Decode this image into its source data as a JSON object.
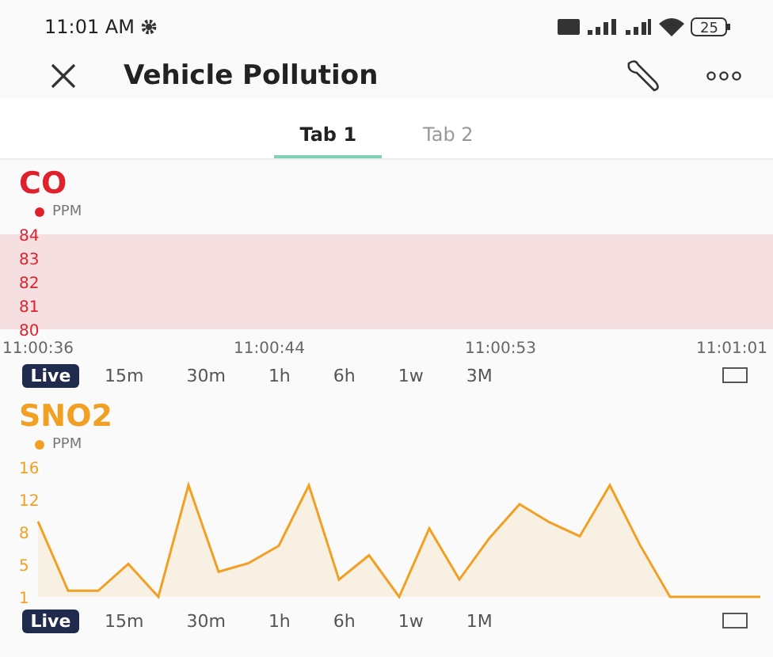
{
  "status_bar": {
    "time": "11:01 AM",
    "battery": "25"
  },
  "header": {
    "title": "Vehicle Pollution"
  },
  "tabs": [
    {
      "label": "Tab 1",
      "selected": true
    },
    {
      "label": "Tab 2",
      "selected": false
    }
  ],
  "panels": [
    {
      "title": "CO",
      "color": "#e0202a",
      "legend": "PPM",
      "y_labels": [
        "84",
        "83",
        "82",
        "81",
        "80"
      ],
      "x_labels": [
        "11:00:36",
        "11:00:44",
        "11:00:53",
        "11:01:01"
      ],
      "ranges": [
        {
          "label": "Live",
          "selected": true
        },
        {
          "label": "15m",
          "selected": false
        },
        {
          "label": "30m",
          "selected": false
        },
        {
          "label": "1h",
          "selected": false
        },
        {
          "label": "6h",
          "selected": false
        },
        {
          "label": "1w",
          "selected": false
        },
        {
          "label": "3M",
          "selected": false
        }
      ]
    },
    {
      "title": "SNO2",
      "color": "#f2a024",
      "chart_data": {
        "type": "area",
        "series": [
          {
            "name": "PPM",
            "color": "#f2a024",
            "values": [
              9.7,
              1.7,
              1.7,
              4.8,
              1,
              13.9,
              3.9,
              4.9,
              6.9,
              13.9,
              3,
              5.8,
              1,
              8.9,
              3,
              7.8,
              11.7,
              9.6,
              8,
              13.9,
              7,
              1,
              1,
              1,
              1
            ]
          }
        ],
        "ylim": [
          1,
          16
        ],
        "yticks": [
          {
            "value": 1,
            "label": "1"
          },
          {
            "value": 4.75,
            "label": "5"
          },
          {
            "value": 8.5,
            "label": "8"
          },
          {
            "value": 12.25,
            "label": "12"
          },
          {
            "value": 16,
            "label": "16"
          }
        ]
      },
      "ranges": [
        {
          "label": "Live",
          "selected": true
        },
        {
          "label": "15m",
          "selected": false
        },
        {
          "label": "30m",
          "selected": false
        },
        {
          "label": "1h",
          "selected": false
        },
        {
          "label": "6h",
          "selected": false
        },
        {
          "label": "1w",
          "selected": false
        },
        {
          "label": "1M",
          "selected": false
        }
      ]
    }
  ]
}
